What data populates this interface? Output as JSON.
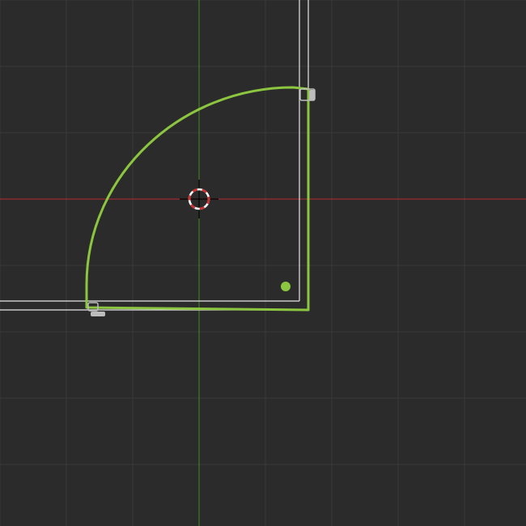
{
  "viewport": {
    "view": "top-orthographic",
    "background_color": "#2b2b2b",
    "grid": {
      "visible": true,
      "color": "#3a3a3a",
      "subdivision_color": "#303030"
    },
    "axes": {
      "x_axis_color": "#9c2b33",
      "y_axis_color": "#3f7d1e"
    }
  },
  "scene": {
    "wireframe_walls": {
      "color": "#e6e6e6"
    },
    "selected_curve": {
      "shape": "quarter-circle",
      "state": "selected",
      "color": "#8cc53f"
    },
    "curve_origin_point": {
      "color": "#8cc53f"
    },
    "snap_handles": {
      "color": "#bdbdbd"
    },
    "3d_cursor": {
      "ring_color_a": "#ffffff",
      "ring_color_b": "#d03030",
      "crosshair_color": "#000000"
    }
  }
}
